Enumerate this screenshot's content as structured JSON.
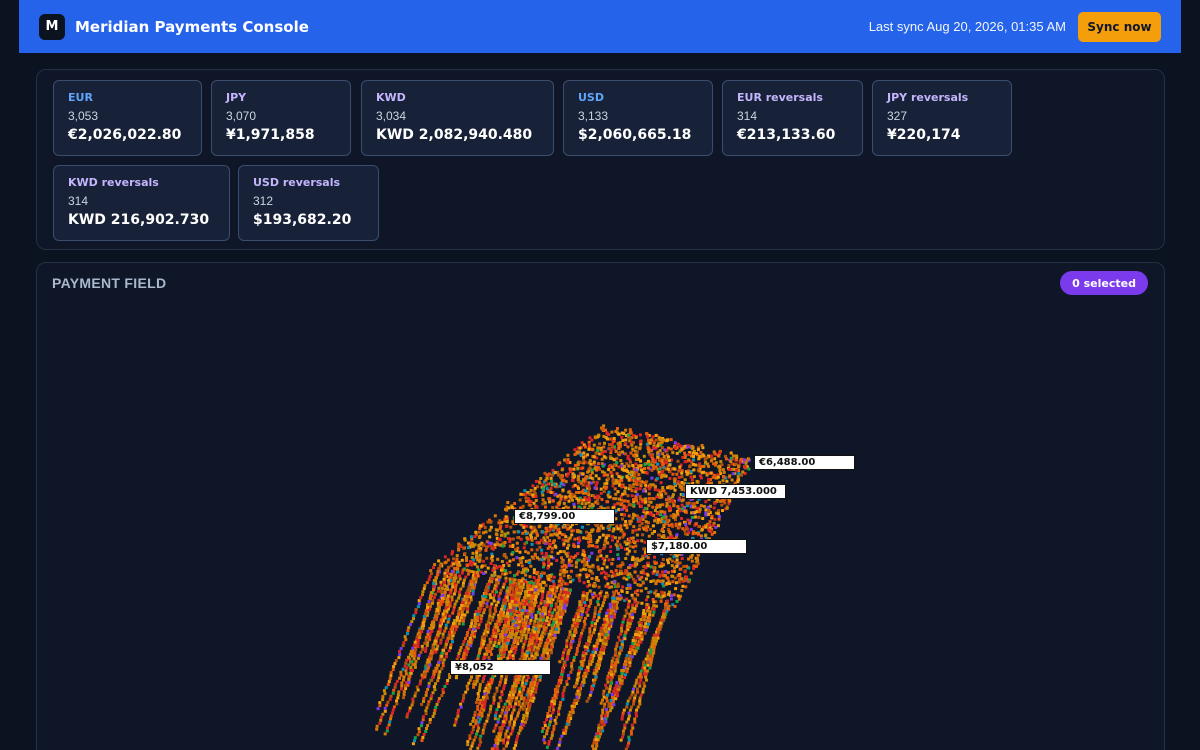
{
  "header": {
    "logo_letter": "M",
    "title": "Meridian Payments Console",
    "last_sync": "Last sync Aug 20, 2026, 01:35 AM",
    "sync_button": "Sync now",
    "bar_color": "#2563eb",
    "button_color": "#f59e0b"
  },
  "summary": {
    "cards": [
      {
        "label": "EUR",
        "count": "3,053",
        "total": "€2,026,022.80",
        "kind": "currency"
      },
      {
        "label": "JPY",
        "count": "3,070",
        "total": "¥1,971,858",
        "kind": "currency"
      },
      {
        "label": "KWD",
        "count": "3,034",
        "total": "KWD 2,082,940.480",
        "kind": "currency"
      },
      {
        "label": "USD",
        "count": "3,133",
        "total": "$2,060,665.18",
        "kind": "currency"
      },
      {
        "label": "EUR reversals",
        "count": "314",
        "total": "€213,133.60",
        "kind": "reversal"
      },
      {
        "label": "JPY reversals",
        "count": "327",
        "total": "¥220,174",
        "kind": "reversal"
      },
      {
        "label": "KWD reversals",
        "count": "314",
        "total": "KWD 216,902.730",
        "kind": "reversal"
      },
      {
        "label": "USD reversals",
        "count": "312",
        "total": "$193,682.20",
        "kind": "reversal"
      }
    ]
  },
  "field": {
    "title": "PAYMENT FIELD",
    "selected_badge": "0 selected",
    "particle_colors": [
      "#d97706",
      "#ea580c",
      "#ca8a04",
      "#b45309",
      "#f59e0b",
      "#dc2626",
      "#7c3aed",
      "#16a34a",
      "#0891b2"
    ],
    "tags": [
      {
        "text": "€6,488.00"
      },
      {
        "text": "KWD 7,453.000"
      },
      {
        "text": "€8,799.00"
      },
      {
        "text": "$7,180.00"
      },
      {
        "text": "¥8,052"
      }
    ]
  }
}
